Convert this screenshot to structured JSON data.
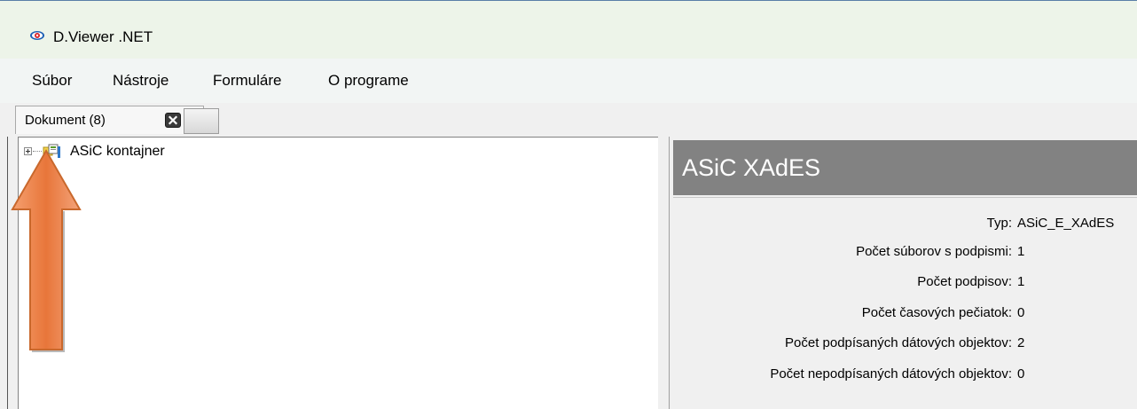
{
  "window": {
    "title": "D.Viewer .NET",
    "icon": "eye-icon"
  },
  "menu": {
    "items": [
      {
        "label": "Súbor"
      },
      {
        "label": "Nástroje"
      },
      {
        "label": "Formuláre"
      },
      {
        "label": "O programe"
      }
    ]
  },
  "tabs": {
    "document_tab_label": "Dokument (8)",
    "close_icon": "close-icon"
  },
  "tree": {
    "nodes": [
      {
        "label": "ASiC kontajner",
        "icon": "container-icon",
        "expanded": false
      }
    ]
  },
  "details": {
    "title": "ASiC XAdES",
    "properties": [
      {
        "label": "Typ:",
        "value": "ASiC_E_XAdES"
      },
      {
        "label": "Počet súborov s podpismi:",
        "value": "1"
      },
      {
        "label": "Počet podpisov:",
        "value": "1"
      },
      {
        "label": "Počet časových pečiatok:",
        "value": "0"
      },
      {
        "label": "Počet podpísaných dátových objektov:",
        "value": "2"
      },
      {
        "label": "Počet nepodpísaných dátových objektov:",
        "value": "0"
      }
    ]
  },
  "annotation": {
    "arrow_color": "#e8763a",
    "arrow_direction": "up"
  },
  "colors": {
    "titlebar_bg": "#edf4e9",
    "details_header_bg": "#828282"
  }
}
